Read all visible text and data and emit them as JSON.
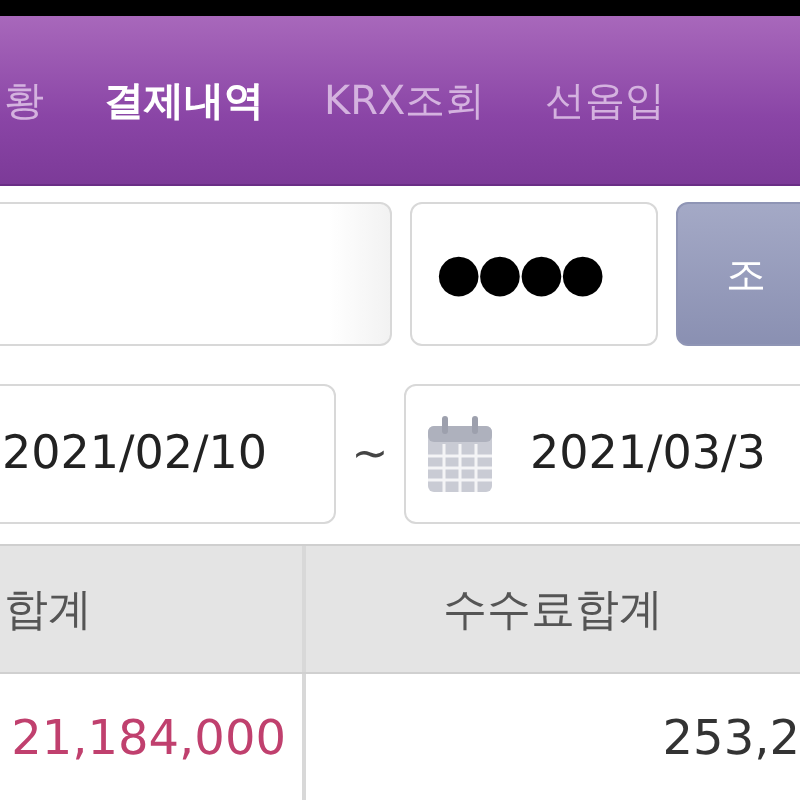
{
  "tabs": [
    {
      "label": "황",
      "selected": false
    },
    {
      "label": "결제내역",
      "selected": true
    },
    {
      "label": "KRX조회",
      "selected": false
    },
    {
      "label": "선옵입",
      "selected": false
    }
  ],
  "password_field": {
    "value": "●●●●"
  },
  "search_button": {
    "label": "조"
  },
  "date_range": {
    "from": "2021/02/10",
    "separator": "~",
    "to": "2021/03/3"
  },
  "table": {
    "columns": [
      "합계",
      "수수료합계"
    ],
    "rows": [
      [
        {
          "text": "21,184,000",
          "emphasized": true
        },
        {
          "text": "253,2",
          "emphasized": false
        }
      ]
    ]
  }
}
